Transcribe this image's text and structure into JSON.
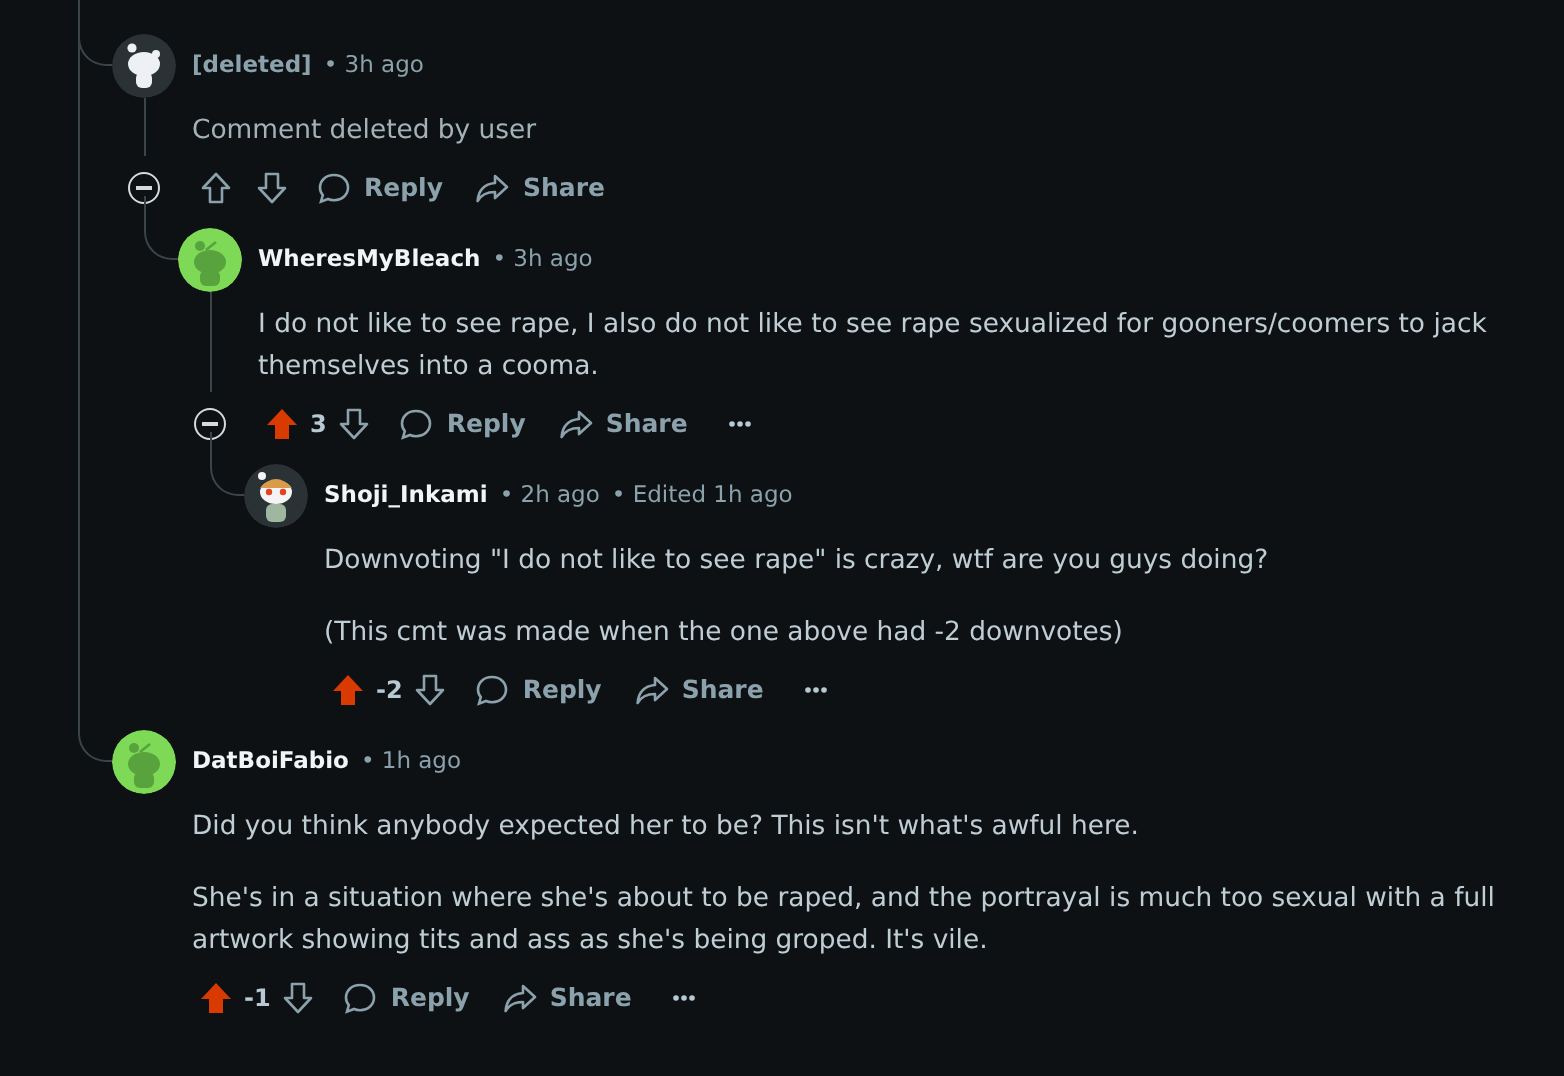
{
  "thread": [
    {
      "author": "[deleted]",
      "avatar": {
        "kind": "deleted"
      },
      "time": "• 3h ago",
      "body": {
        "kind": "removed",
        "paragraphs": [
          "Comment deleted by user"
        ]
      },
      "upvoted": false,
      "actions": {
        "reply": "Reply",
        "share": "Share"
      },
      "more": false,
      "children": [
        {
          "author": "WheresMyBleach",
          "avatar": {
            "kind": "default"
          },
          "time": "• 3h ago",
          "body": {
            "kind": "normal",
            "paragraphs": [
              "I do not like to see rape, I also do not like to see rape sexualized for gooners/coomers to jack themselves into a cooma."
            ]
          },
          "upvoted": true,
          "score": "3",
          "actions": {
            "reply": "Reply",
            "share": "Share"
          },
          "more": true,
          "children": [
            {
              "author": "Shoji_Inkami",
              "avatar": {
                "kind": "custom"
              },
              "time": "• 2h ago",
              "edited": "• Edited 1h ago",
              "body": {
                "kind": "normal",
                "paragraphs": [
                  "Downvoting \"I do not like to see rape\" is crazy, wtf are you guys doing?",
                  "(This cmt was made when the one above had -2 downvotes)"
                ]
              },
              "upvoted": true,
              "score": "-2",
              "actions": {
                "reply": "Reply",
                "share": "Share"
              },
              "more": true
            }
          ]
        }
      ]
    },
    {
      "author": "DatBoiFabio",
      "avatar": {
        "kind": "default"
      },
      "time": "• 1h ago",
      "body": {
        "kind": "normal",
        "paragraphs": [
          "Did you think anybody expected her to be? This isn't what's awful here.",
          "She's in a situation where she's about to be raped, and the portrayal is much too sexual with a full artwork showing tits and ass as she's being groped. It's vile."
        ]
      },
      "upvoted": true,
      "score": "-1",
      "actions": {
        "reply": "Reply",
        "share": "Share"
      },
      "more": true
    }
  ]
}
